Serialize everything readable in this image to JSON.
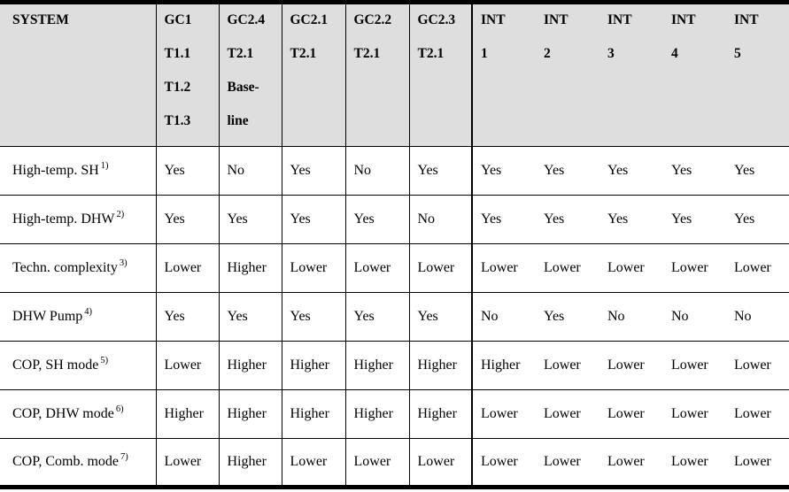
{
  "table": {
    "header": {
      "system_label": "SYSTEM",
      "columns": [
        {
          "lines": [
            "GC1",
            "T1.1",
            "T1.2",
            "T1.3"
          ]
        },
        {
          "lines": [
            "GC2.4",
            "T2.1",
            "Base-",
            "line"
          ]
        },
        {
          "lines": [
            "GC2.1",
            "T2.1",
            "",
            ""
          ]
        },
        {
          "lines": [
            "GC2.2",
            "T2.1",
            "",
            ""
          ]
        },
        {
          "lines": [
            "GC2.3",
            "T2.1",
            "",
            ""
          ]
        },
        {
          "lines": [
            "INT",
            "1",
            "",
            ""
          ]
        },
        {
          "lines": [
            "INT",
            "2",
            "",
            ""
          ]
        },
        {
          "lines": [
            "INT",
            "3",
            "",
            ""
          ]
        },
        {
          "lines": [
            "INT",
            "4",
            "",
            ""
          ]
        },
        {
          "lines": [
            "INT",
            "5",
            "",
            ""
          ]
        }
      ]
    },
    "rows": [
      {
        "label": "High-temp. SH",
        "footnote": "1)",
        "values": [
          "Yes",
          "No",
          "Yes",
          "No",
          "Yes",
          "Yes",
          "Yes",
          "Yes",
          "Yes",
          "Yes"
        ]
      },
      {
        "label": "High-temp. DHW",
        "footnote": "2)",
        "values": [
          "Yes",
          "Yes",
          "Yes",
          "Yes",
          "No",
          "Yes",
          "Yes",
          "Yes",
          "Yes",
          "Yes"
        ]
      },
      {
        "label": "Techn. complexity",
        "footnote": "3)",
        "values": [
          "Lower",
          "Higher",
          "Lower",
          "Lower",
          "Lower",
          "Lower",
          "Lower",
          "Lower",
          "Lower",
          "Lower"
        ]
      },
      {
        "label": "DHW Pump",
        "footnote": "4)",
        "values": [
          "Yes",
          "Yes",
          "Yes",
          "Yes",
          "Yes",
          "No",
          "Yes",
          "No",
          "No",
          "No"
        ]
      },
      {
        "label": "COP, SH mode",
        "footnote": "5)",
        "values": [
          "Lower",
          "Higher",
          "Higher",
          "Higher",
          "Higher",
          "Higher",
          "Lower",
          "Lower",
          "Lower",
          "Lower"
        ]
      },
      {
        "label": "COP, DHW mode",
        "footnote": "6)",
        "values": [
          "Higher",
          "Higher",
          "Higher",
          "Higher",
          "Higher",
          "Lower",
          "Lower",
          "Lower",
          "Lower",
          "Lower"
        ]
      },
      {
        "label": "COP, Comb. mode",
        "footnote": "7)",
        "values": [
          "Lower",
          "Higher",
          "Lower",
          "Lower",
          "Lower",
          "Lower",
          "Lower",
          "Lower",
          "Lower",
          "Lower"
        ]
      }
    ]
  },
  "style": {
    "header_background": "#dedede",
    "border_color": "#000000",
    "text_color": "#000000"
  }
}
